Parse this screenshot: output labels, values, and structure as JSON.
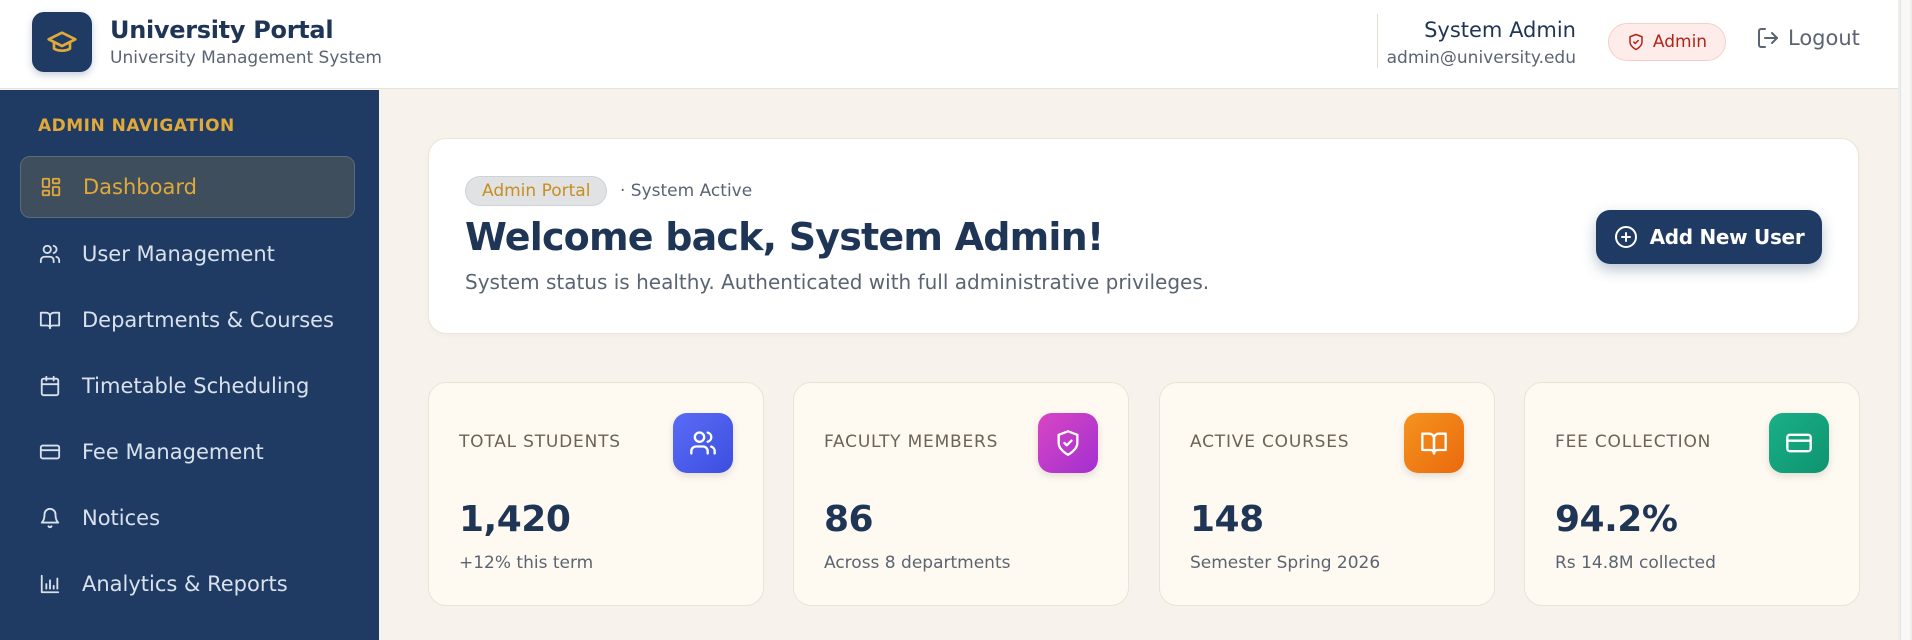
{
  "header": {
    "app_title": "University Portal",
    "app_subtitle": "University Management System",
    "user_name": "System Admin",
    "user_email": "admin@university.edu",
    "role_badge": "Admin",
    "logout_label": "Logout"
  },
  "sidebar": {
    "heading": "ADMIN NAVIGATION",
    "items": [
      {
        "label": "Dashboard",
        "icon": "dashboard-grid-icon",
        "active": true
      },
      {
        "label": "User Management",
        "icon": "users-icon"
      },
      {
        "label": "Departments & Courses",
        "icon": "book-icon"
      },
      {
        "label": "Timetable Scheduling",
        "icon": "calendar-icon"
      },
      {
        "label": "Fee Management",
        "icon": "credit-card-icon"
      },
      {
        "label": "Notices",
        "icon": "bell-icon"
      },
      {
        "label": "Analytics & Reports",
        "icon": "bar-chart-icon"
      }
    ]
  },
  "welcome": {
    "pill": "Admin Portal",
    "status": "· System Active",
    "title": "Welcome back, System Admin!",
    "description": "System status is healthy. Authenticated with full administrative privileges.",
    "add_button": "Add New User"
  },
  "stats": [
    {
      "label": "TOTAL STUDENTS",
      "value": "1,420",
      "sub": "+12% this term",
      "icon": "users-icon",
      "color": "#4f5ef0"
    },
    {
      "label": "FACULTY MEMBERS",
      "value": "86",
      "sub": "Across 8 departments",
      "icon": "shield-check-icon",
      "color": "#c73ac9"
    },
    {
      "label": "ACTIVE COURSES",
      "value": "148",
      "sub": "Semester Spring 2026",
      "icon": "book-open-icon",
      "color": "#f07d16"
    },
    {
      "label": "FEE COLLECTION",
      "value": "94.2%",
      "sub": "Rs 14.8M collected",
      "icon": "credit-card-icon",
      "color": "#14a07a"
    }
  ],
  "colors": {
    "navy": "#1f3b63",
    "accent_gold": "#e0a93a",
    "background": "#f7f3ec",
    "admin_red": "#b42318"
  }
}
